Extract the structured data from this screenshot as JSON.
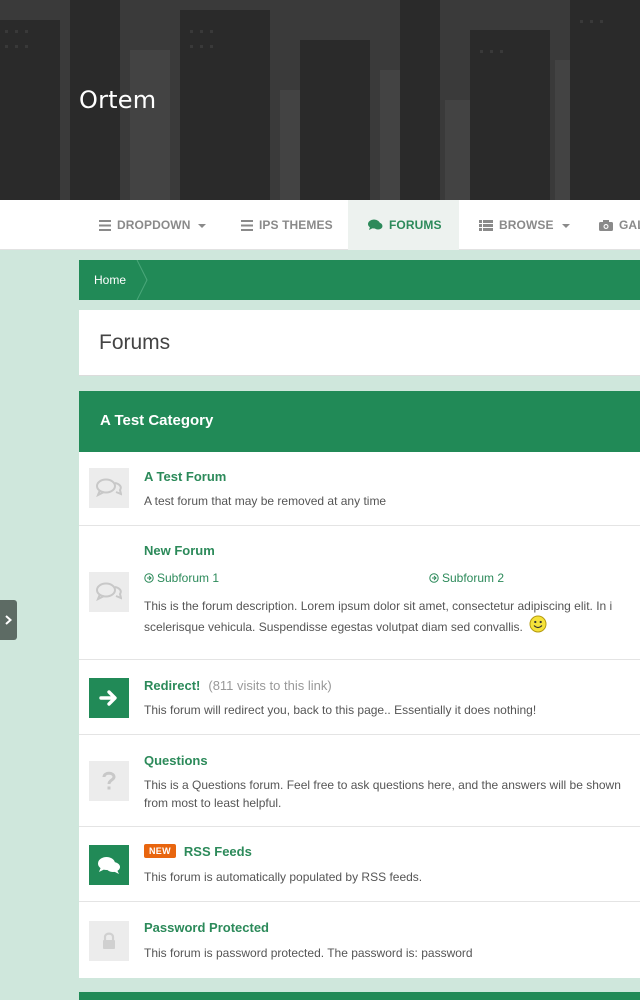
{
  "site": {
    "title": "Ortem"
  },
  "nav": {
    "items": [
      {
        "label": "DROPDOWN",
        "icon": "list-icon",
        "dropdown": true
      },
      {
        "label": "IPS THEMES",
        "icon": "list-icon",
        "dropdown": false
      },
      {
        "label": "FORUMS",
        "icon": "comments-icon",
        "dropdown": false,
        "active": true
      },
      {
        "label": "BROWSE",
        "icon": "grid-list-icon",
        "dropdown": true
      },
      {
        "label": "GAL",
        "icon": "camera-icon",
        "dropdown": false
      }
    ]
  },
  "breadcrumb": {
    "home": "Home"
  },
  "page": {
    "title": "Forums"
  },
  "category": {
    "title": "A Test Category",
    "forums": [
      {
        "name": "A Test Forum",
        "description": "A test forum that may be removed at any time",
        "icon": "comments-icon"
      },
      {
        "name": "New Forum",
        "subforums": [
          "Subforum 1",
          "Subforum 2"
        ],
        "description_line1": "This is the forum description. Lorem ipsum dolor sit amet, consectetur adipiscing elit. In i",
        "description_line2": "scelerisque vehicula. Suspendisse egestas volutpat diam sed convallis.",
        "icon": "comments-icon"
      },
      {
        "name": "Redirect!",
        "visits": "(811 visits to this link)",
        "description": "This forum will redirect you, back to this page.. Essentially it does nothing!",
        "icon": "arrow-right-icon"
      },
      {
        "name": "Questions",
        "description_line1": "This is a Questions forum. Feel free to ask questions here, and the answers will be shown",
        "description_line2": "from most to least helpful.",
        "icon": "question-icon"
      },
      {
        "name": "RSS Feeds",
        "badge": "NEW",
        "description": "This forum is automatically populated by RSS feeds.",
        "icon": "comments-icon"
      },
      {
        "name": "Password Protected",
        "description": "This forum is password protected. The password is: password",
        "icon": "lock-icon"
      }
    ]
  },
  "colors": {
    "brand": "#218a57",
    "link": "#2c8a5a",
    "badge": "#e8650e",
    "background": "#cfe7dc"
  }
}
